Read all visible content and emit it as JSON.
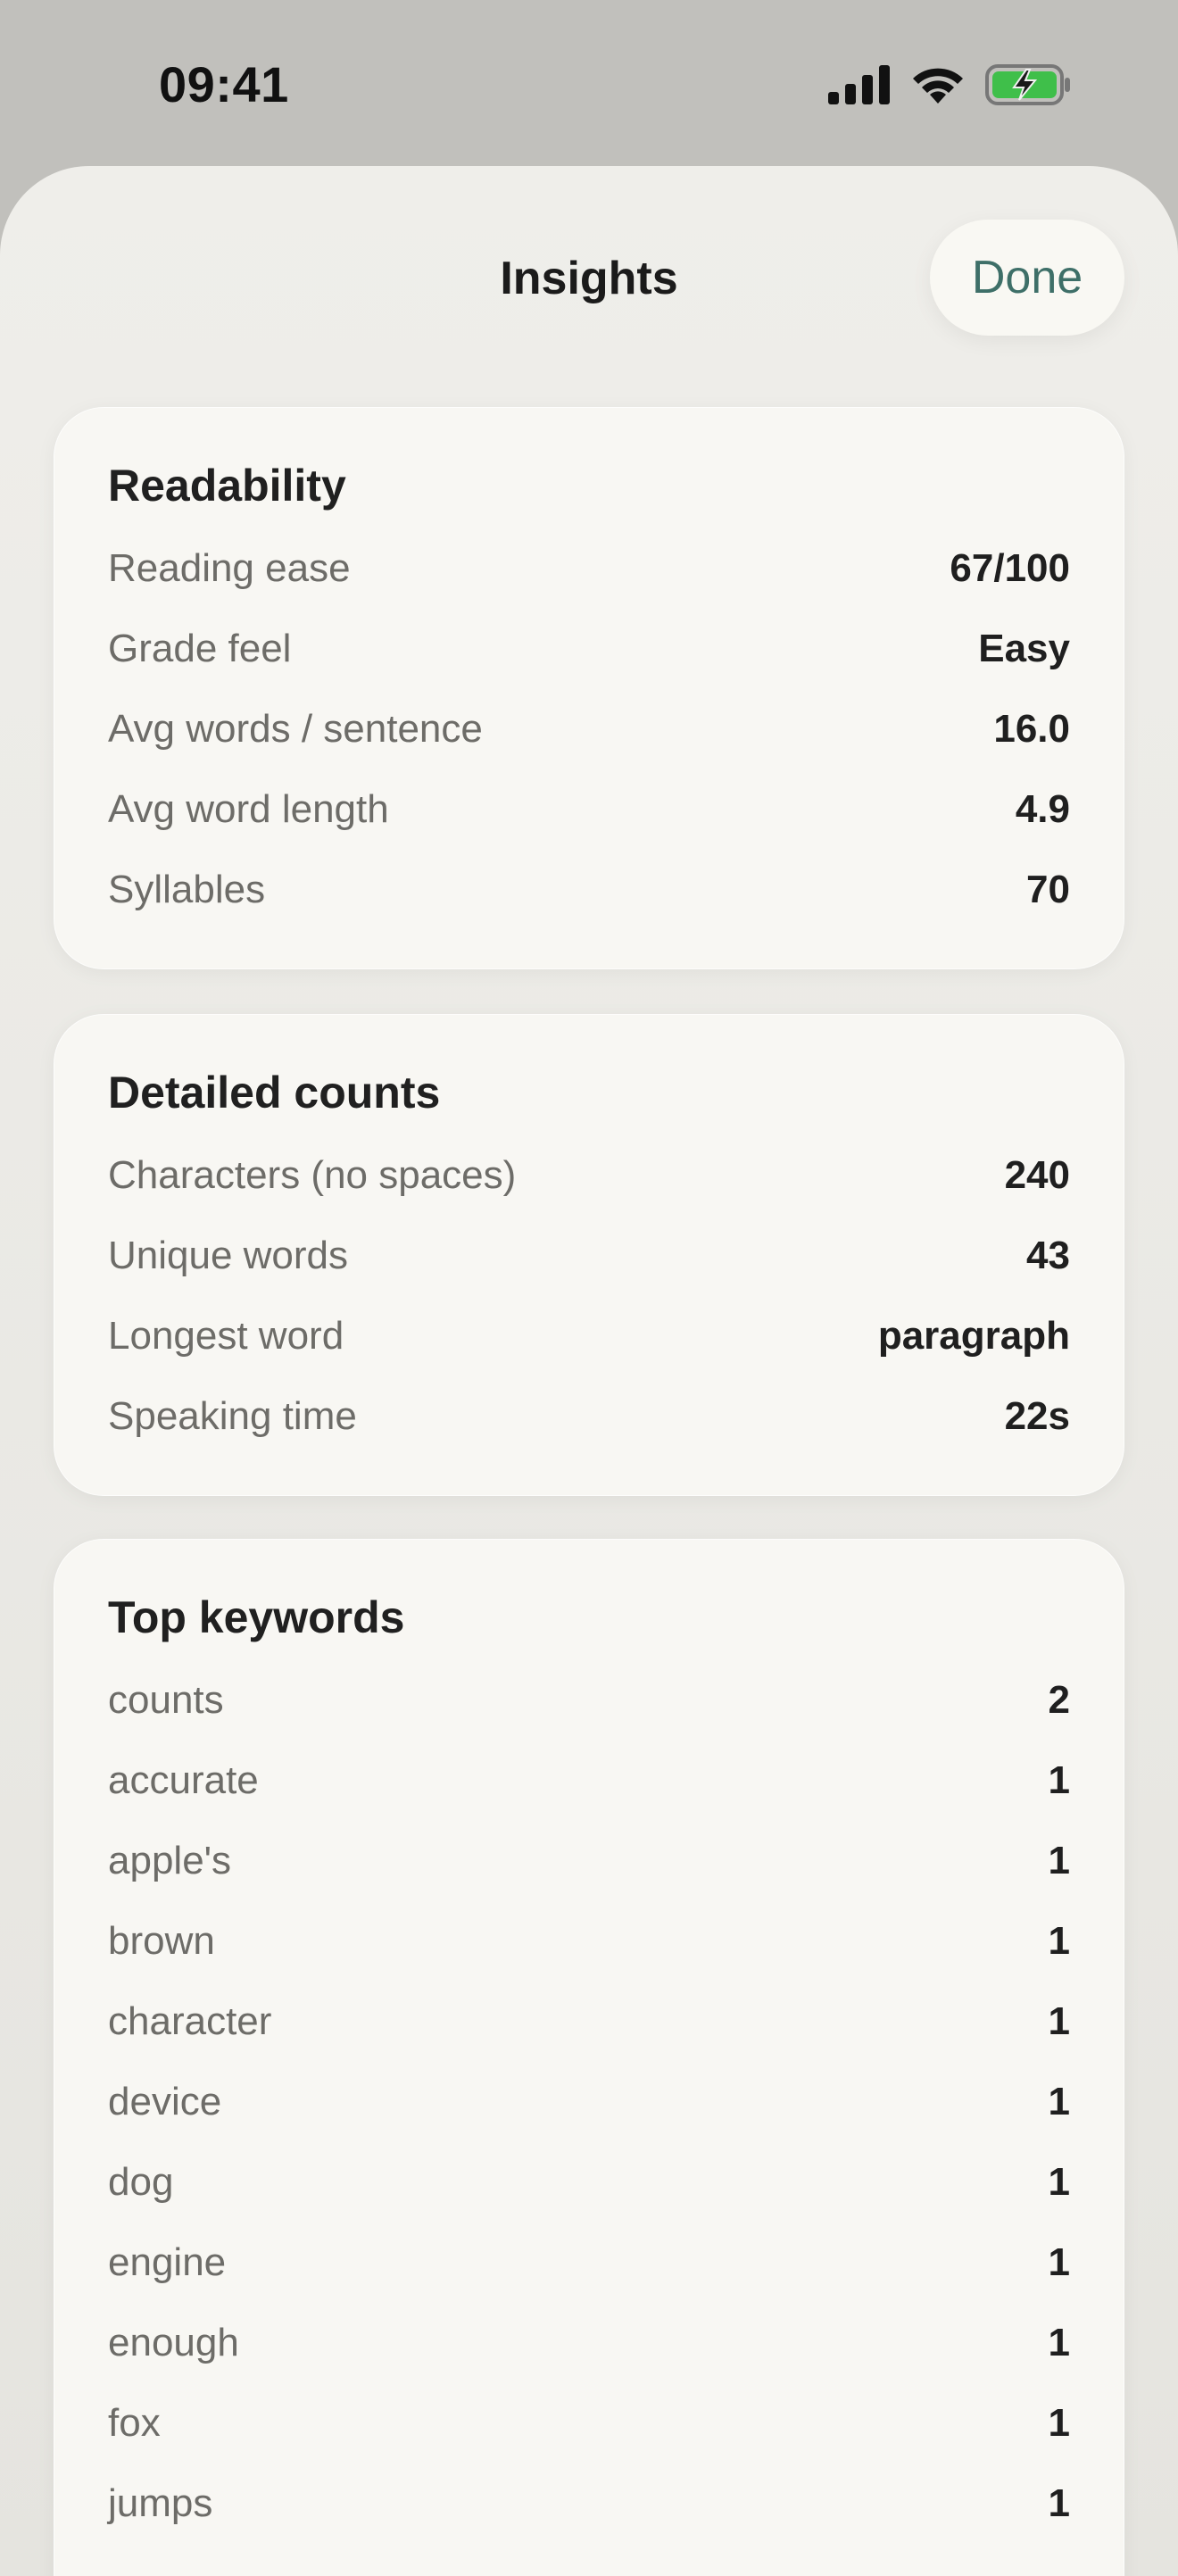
{
  "status": {
    "time": "09:41"
  },
  "sheet": {
    "title": "Insights",
    "done_label": "Done"
  },
  "readability": {
    "title": "Readability",
    "rows": [
      {
        "label": "Reading ease",
        "value": "67/100"
      },
      {
        "label": "Grade feel",
        "value": "Easy"
      },
      {
        "label": "Avg words / sentence",
        "value": "16.0"
      },
      {
        "label": "Avg word length",
        "value": "4.9"
      },
      {
        "label": "Syllables",
        "value": "70"
      }
    ]
  },
  "counts": {
    "title": "Detailed counts",
    "rows": [
      {
        "label": "Characters (no spaces)",
        "value": "240"
      },
      {
        "label": "Unique words",
        "value": "43"
      },
      {
        "label": "Longest word",
        "value": "paragraph"
      },
      {
        "label": "Speaking time",
        "value": "22s"
      }
    ]
  },
  "keywords": {
    "title": "Top keywords",
    "rows": [
      {
        "label": "counts",
        "value": "2"
      },
      {
        "label": "accurate",
        "value": "1"
      },
      {
        "label": "apple's",
        "value": "1"
      },
      {
        "label": "brown",
        "value": "1"
      },
      {
        "label": "character",
        "value": "1"
      },
      {
        "label": "device",
        "value": "1"
      },
      {
        "label": "dog",
        "value": "1"
      },
      {
        "label": "engine",
        "value": "1"
      },
      {
        "label": "enough",
        "value": "1"
      },
      {
        "label": "fox",
        "value": "1"
      },
      {
        "label": "jumps",
        "value": "1"
      }
    ]
  },
  "colors": {
    "accent": "#3e6f68",
    "battery": "#3fbf4a"
  }
}
